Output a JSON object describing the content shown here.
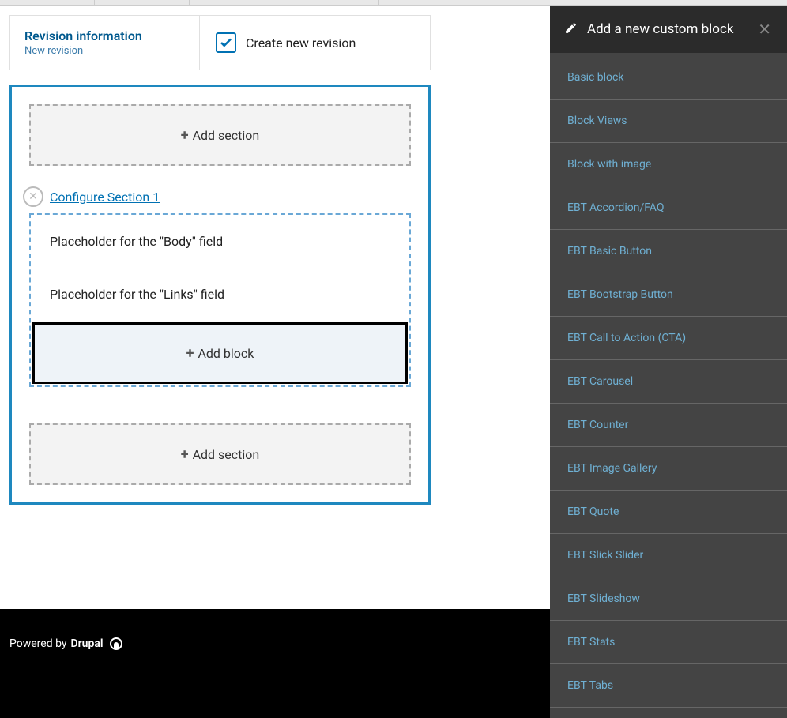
{
  "revision": {
    "title": "Revision information",
    "subtitle": "New revision",
    "checkbox_label": "Create new revision"
  },
  "layout": {
    "add_section_label": "Add section",
    "configure_label": "Configure Section 1",
    "placeholder_body": "Placeholder for the \"Body\" field",
    "placeholder_links": "Placeholder for the \"Links\" field",
    "add_block_label": "Add block"
  },
  "footer": {
    "powered_by": "Powered by ",
    "drupal": "Drupal"
  },
  "sidebar": {
    "title": "Add a new custom block",
    "blocks": [
      "Basic block",
      "Block Views",
      "Block with image",
      "EBT Accordion/FAQ",
      "EBT Basic Button",
      "EBT Bootstrap Button",
      "EBT Call to Action (CTA)",
      "EBT Carousel",
      "EBT Counter",
      "EBT Image Gallery",
      "EBT Quote",
      "EBT Slick Slider",
      "EBT Slideshow",
      "EBT Stats",
      "EBT Tabs"
    ]
  }
}
